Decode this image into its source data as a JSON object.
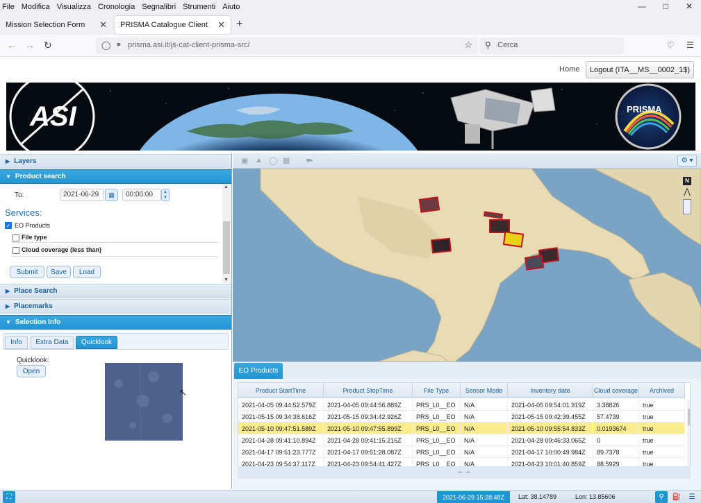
{
  "browser": {
    "menu": [
      "File",
      "Modifica",
      "Visualizza",
      "Cronologia",
      "Segnalibri",
      "Strumenti",
      "Aiuto"
    ],
    "tabs": [
      {
        "label": "Mission Selection Form"
      },
      {
        "label": "PRISMA Catalogue Client"
      }
    ],
    "url": "prisma.asi.it/js-cat-client-prisma-src/",
    "search_placeholder": "Cerca"
  },
  "header": {
    "home_label": "Home",
    "logout_label": "Logout (ITA__MS__0002_1$)",
    "banner_logo_text": "ASI",
    "banner_mission_text": "PRISMA"
  },
  "left_panel": {
    "sections": {
      "layers": "Layers",
      "product_search": "Product search",
      "place_search": "Place Search",
      "placemarks": "Placemarks",
      "selection_info": "Selection Info"
    },
    "to_label": "To:",
    "to_date": "2021-06-29",
    "to_time": "00:00:00",
    "services_label": "Services:",
    "eo_products_label": "EO Products",
    "file_type_label": "File type",
    "cloud_coverage_label": "Cloud coverage (less than)",
    "submit_label": "Submit",
    "save_label": "Save",
    "load_label": "Load",
    "subtabs": {
      "info": "Info",
      "extra": "Extra Data",
      "quicklook": "Quicklook"
    },
    "quicklook_label": "Quicklook:",
    "open_label": "Open"
  },
  "map": {
    "compass_label": "N"
  },
  "table": {
    "tab_label": "EO Products",
    "columns": [
      "Product StartTime",
      "Product StopTime",
      "File Type",
      "Sensor Mode",
      "Inventory date",
      "Cloud coverage",
      "Archived"
    ],
    "rows": [
      [
        "2021-04-05 09:44:52.579Z",
        "2021-04-05 09:44:56.889Z",
        "PRS_L0__EO",
        "N/A",
        "2021-04-05 09:54:01.919Z",
        "3.38826",
        "true"
      ],
      [
        "2021-05-15 09:34:38.616Z",
        "2021-05-15 09:34:42.926Z",
        "PRS_L0__EO",
        "N/A",
        "2021-05-15 09:42:39.455Z",
        "57.4739",
        "true"
      ],
      [
        "2021-05-10 09:47:51.589Z",
        "2021-05-10 09:47:55.899Z",
        "PRS_L0__EO",
        "N/A",
        "2021-05-10 09:55:54.833Z",
        "0.0193674",
        "true"
      ],
      [
        "2021-04-28 09:41:10.894Z",
        "2021-04-28 09:41:15.216Z",
        "PRS_L0__EO",
        "N/A",
        "2021-04-28 09:46:33.065Z",
        "0",
        "true"
      ],
      [
        "2021-04-17 09:51:23.777Z",
        "2021-04-17 09:51:28.087Z",
        "PRS_L0__EO",
        "N/A",
        "2021-04-17 10:00:49.984Z",
        "89.7378",
        "true"
      ],
      [
        "2021-04-23 09:54:37.117Z",
        "2021-04-23 09:54:41.427Z",
        "PRS_L0__EO",
        "N/A",
        "2021-04-23 10:01:40.859Z",
        "88.5929",
        "true"
      ]
    ],
    "highlighted_row": 2
  },
  "status": {
    "datetime": "2021-06-29 15:28:48Z",
    "lat": "Lat: 38.14789",
    "lon": "Lon: 13.85606"
  },
  "colors": {
    "accent": "#2195d2",
    "highlight_row": "#fbec8f",
    "footprint_outline": "#c0141c",
    "footprint_selected": "#e6d21a"
  }
}
